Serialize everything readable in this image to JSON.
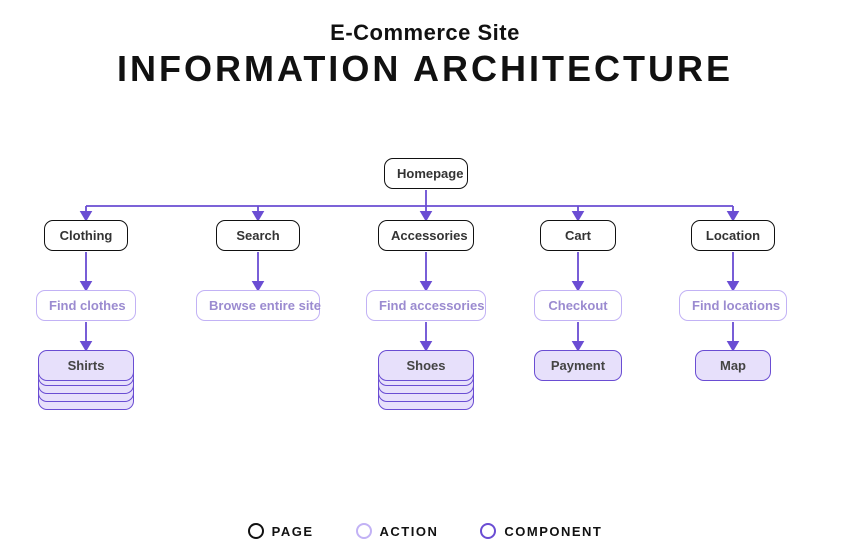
{
  "header": {
    "subtitle": "E-Commerce Site",
    "title": "INFORMATION ARCHITECTURE"
  },
  "root": {
    "label": "Homepage"
  },
  "columns": [
    {
      "page": "Clothing",
      "action": "Find clothes",
      "component": "Shirts",
      "stack": 5
    },
    {
      "page": "Search",
      "action": "Browse entire site",
      "component": null,
      "stack": 0
    },
    {
      "page": "Accessories",
      "action": "Find accessories",
      "component": "Shoes",
      "stack": 5
    },
    {
      "page": "Cart",
      "action": "Checkout",
      "component": "Payment",
      "stack": 1
    },
    {
      "page": "Location",
      "action": "Find locations",
      "component": "Map",
      "stack": 1
    }
  ],
  "legend": {
    "page": "PAGE",
    "action": "ACTION",
    "component": "COMPONENT"
  }
}
